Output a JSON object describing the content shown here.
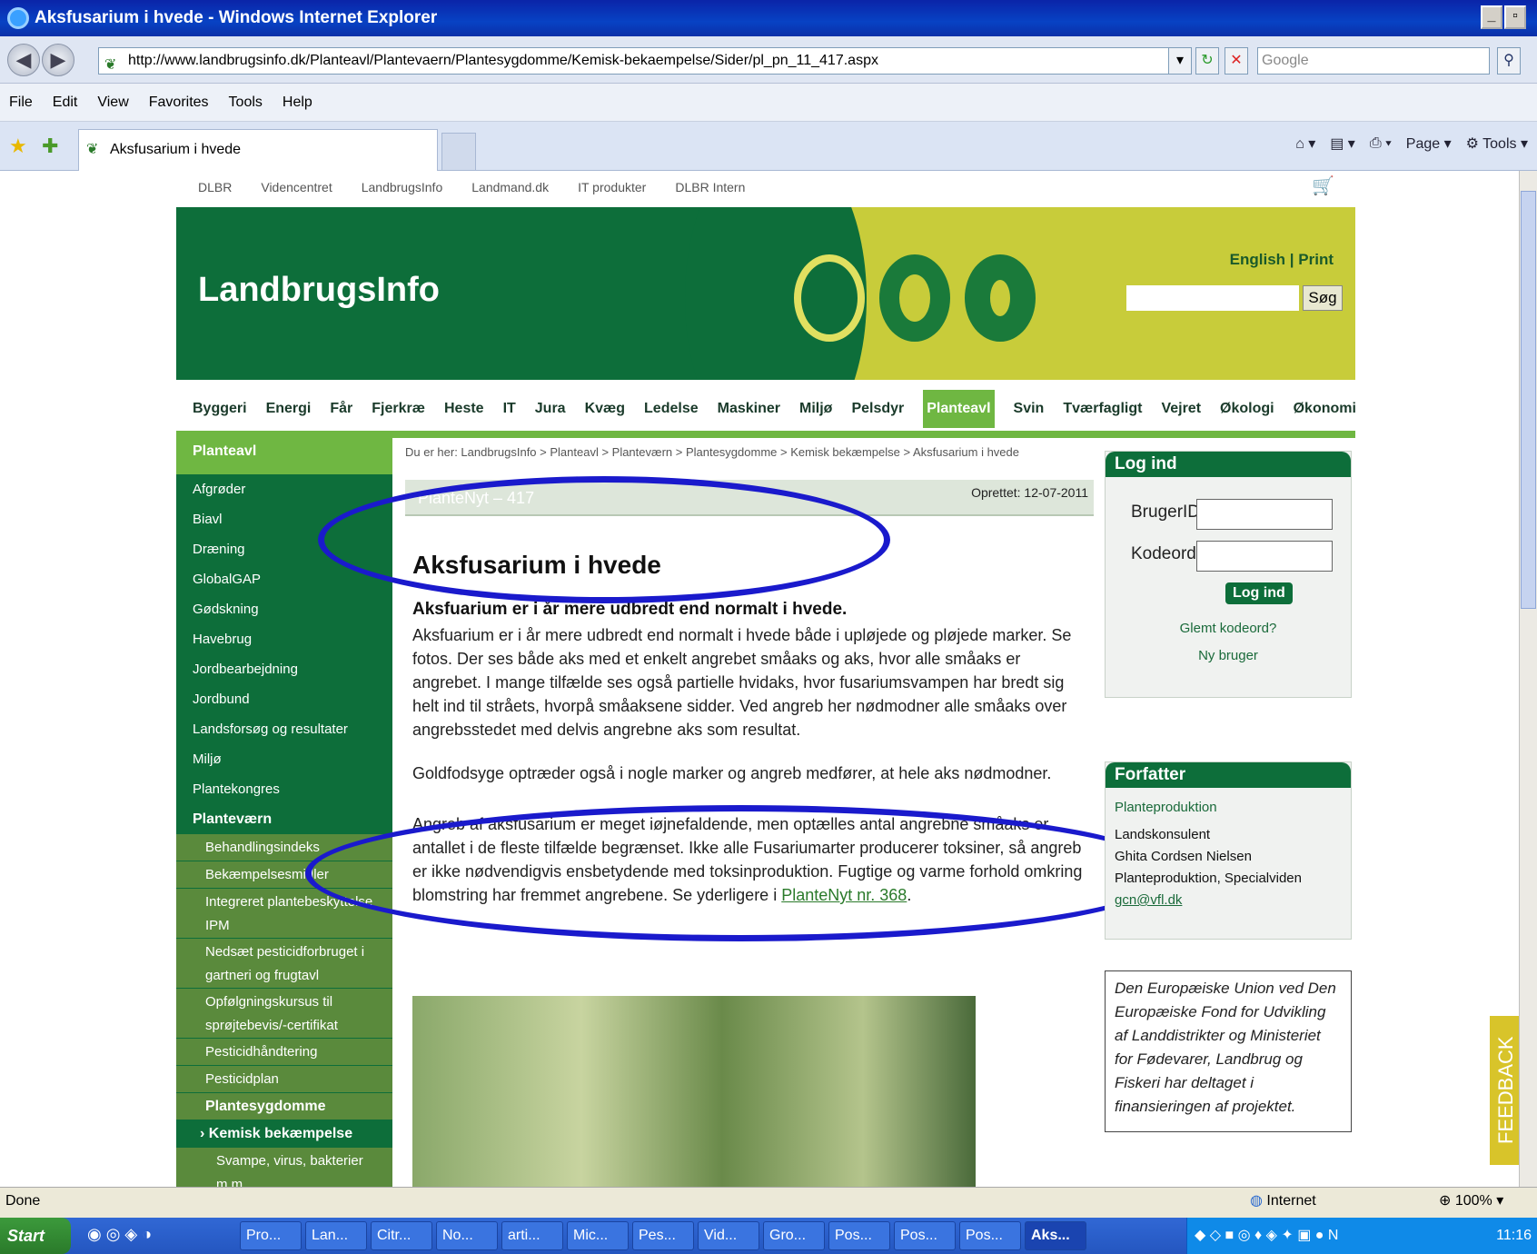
{
  "window": {
    "title": "Aksfusarium i hvede - Windows Internet Explorer"
  },
  "address": {
    "url": "http://www.landbrugsinfo.dk/Planteavl/Plantevaern/Plantesygdomme/Kemisk-bekaempelse/Sider/pl_pn_11_417.aspx",
    "search_placeholder": "Google"
  },
  "menu": [
    "File",
    "Edit",
    "View",
    "Favorites",
    "Tools",
    "Help"
  ],
  "tab": {
    "label": "Aksfusarium i hvede"
  },
  "toolbar": {
    "page": "Page",
    "tools": "Tools"
  },
  "site": {
    "topnav": [
      "DLBR",
      "Videncentret",
      "LandbrugsInfo",
      "Landmand.dk",
      "IT produkter",
      "DLBR Intern"
    ],
    "logo": "LandbrugsInfo",
    "english": "English",
    "print": "Print",
    "search_button": "Søg",
    "mainnav": [
      "Byggeri",
      "Energi",
      "Får",
      "Fjerkræ",
      "Heste",
      "IT",
      "Jura",
      "Kvæg",
      "Ledelse",
      "Maskiner",
      "Miljø",
      "Pelsdyr",
      "Planteavl",
      "Svin",
      "Tværfagligt",
      "Vejret",
      "Økologi",
      "Økonomi"
    ],
    "mainnav_active": "Planteavl"
  },
  "sidebar": {
    "heading": "Planteavl",
    "items": [
      "Afgrøder",
      "Biavl",
      "Dræning",
      "GlobalGAP",
      "Gødskning",
      "Havebrug",
      "Jordbearbejdning",
      "Jordbund",
      "Landsforsøg og resultater",
      "Miljø",
      "Plantekongres",
      "Planteværn"
    ],
    "subitems": [
      "Behandlingsindeks",
      "Bekæmpelsesmidler",
      "Integreret plantebeskyttelse IPM",
      "Nedsæt pesticidforbruget i gartneri og frugtavl",
      "Opfølgningskursus til sprøjtebevis/-certifikat",
      "Pesticidhåndtering",
      "Pesticidplan",
      "Plantesygdomme"
    ],
    "current": "Kemisk bekæmpelse",
    "last": "Svampe, virus, bakterier m.m."
  },
  "article": {
    "breadcrumb": "Du er her: LandbrugsInfo > Planteavl > Planteværn > Plantesygdomme > Kemisk bekæmpelse > Aksfusarium i hvede",
    "plantenyt": "PlanteNyt – 417",
    "created": "Oprettet: 12-07-2011",
    "title": "Aksfusarium i hvede",
    "subtitle": "Aksfuarium er i år mere udbredt end normalt i hvede.",
    "p1": "Aksfuarium er i år mere udbredt end normalt i hvede både i upløjede og pløjede marker. Se fotos. Der ses både aks med et enkelt angrebet småaks og aks, hvor alle småaks er angrebet. I mange tilfælde ses også partielle hvidaks, hvor fusariumsvampen har bredt sig helt ind til stråets, hvorpå småaksene sidder. Ved angreb her nødmodner alle småaks over angrebsstedet med delvis angrebne aks som resultat.",
    "p2": "Goldfodsyge optræder også i nogle marker og angreb medfører, at hele aks nødmodner.",
    "p3": "Angreb af aksfusarium er meget iøjnefaldende, men optælles antal angrebne småaks er antallet i de fleste tilfælde begrænset. Ikke alle Fusariumarter producerer toksiner, så angreb er ikke nødvendigvis ensbetydende med toksinproduktion. Fugtige og varme forhold omkring blomstring har fremmet angrebene. Se yderligere i",
    "p3_link": "PlanteNyt nr. 368",
    "p3_end": "."
  },
  "login": {
    "heading": "Log ind",
    "user_label": "BrugerID",
    "pass_label": "Kodeord",
    "button": "Log ind",
    "forgot": "Glemt kodeord?",
    "new_user": "Ny bruger"
  },
  "author": {
    "heading": "Forfatter",
    "dept": "Planteproduktion",
    "role": "Landskonsulent",
    "name": "Ghita Cordsen Nielsen",
    "unit": "Planteproduktion, Specialviden",
    "email": "gcn@vfl.dk"
  },
  "eu_text": "Den Europæiske Union ved Den Europæiske Fond for Udvikling af Landdistrikter og Ministeriet for Fødevarer, Landbrug og Fiskeri har deltaget i finansieringen af projektet.",
  "feedback": "FEEDBACK",
  "status": {
    "text": "Done",
    "zone": "Internet",
    "zoom": "100%"
  },
  "taskbar": {
    "start": "Start",
    "tasks": [
      "Pro...",
      "Lan...",
      "Citr...",
      "No...",
      "arti...",
      "Mic...",
      "Pes...",
      "Vid...",
      "Gro...",
      "Pos...",
      "Pos...",
      "Pos...",
      "Aks..."
    ],
    "clock": "11:16"
  }
}
